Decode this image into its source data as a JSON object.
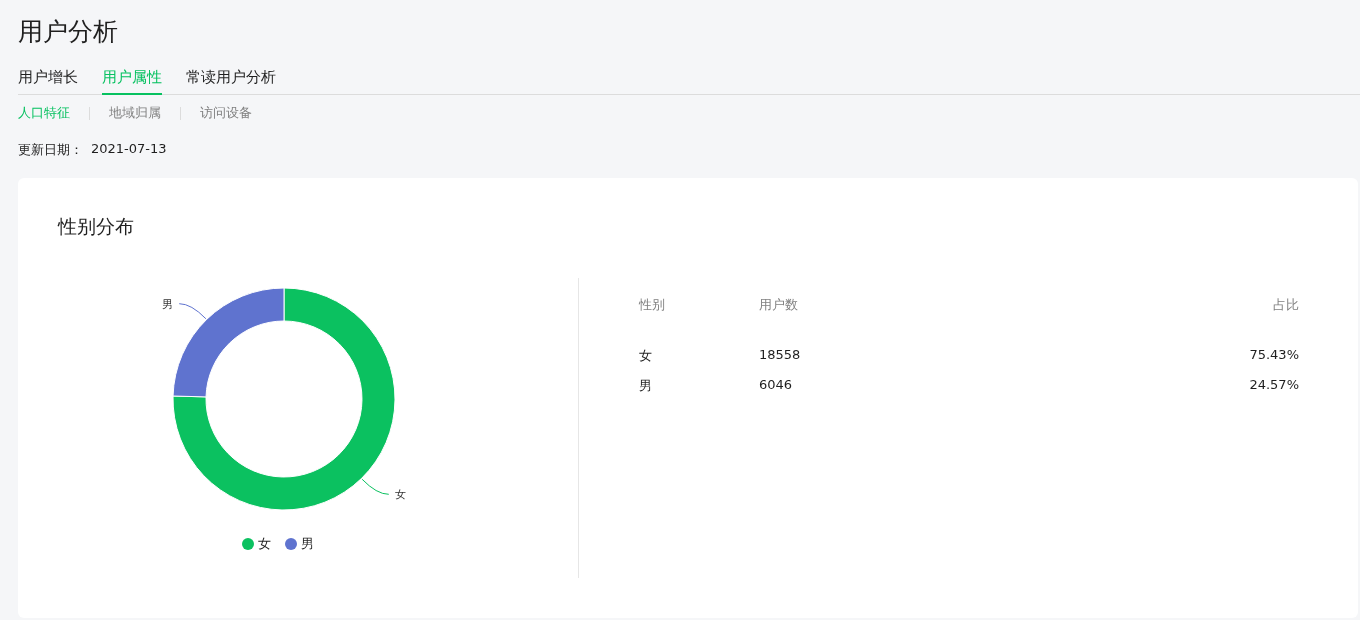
{
  "page_title": "用户分析",
  "tabs": [
    {
      "label": "用户增长",
      "selected": false
    },
    {
      "label": "用户属性",
      "selected": true
    },
    {
      "label": "常读用户分析",
      "selected": false
    }
  ],
  "subtabs": [
    {
      "label": "人口特征",
      "selected": true
    },
    {
      "label": "地域归属",
      "selected": false
    },
    {
      "label": "访问设备",
      "selected": false
    }
  ],
  "update": {
    "label": "更新日期：",
    "value": "2021-07-13"
  },
  "card": {
    "title": "性别分布",
    "chart_data": {
      "type": "donut",
      "categories": [
        "女",
        "男"
      ],
      "values": [
        75.43,
        24.57
      ]
    },
    "legend": [
      {
        "label": "女",
        "color": "#0bc160"
      },
      {
        "label": "男",
        "color": "#5f73cf"
      }
    ],
    "table": {
      "columns": [
        "性别",
        "用户数",
        "占比"
      ],
      "rows": [
        [
          "女",
          "18558",
          "75.43%"
        ],
        [
          "男",
          "6046",
          "24.57%"
        ]
      ]
    }
  }
}
